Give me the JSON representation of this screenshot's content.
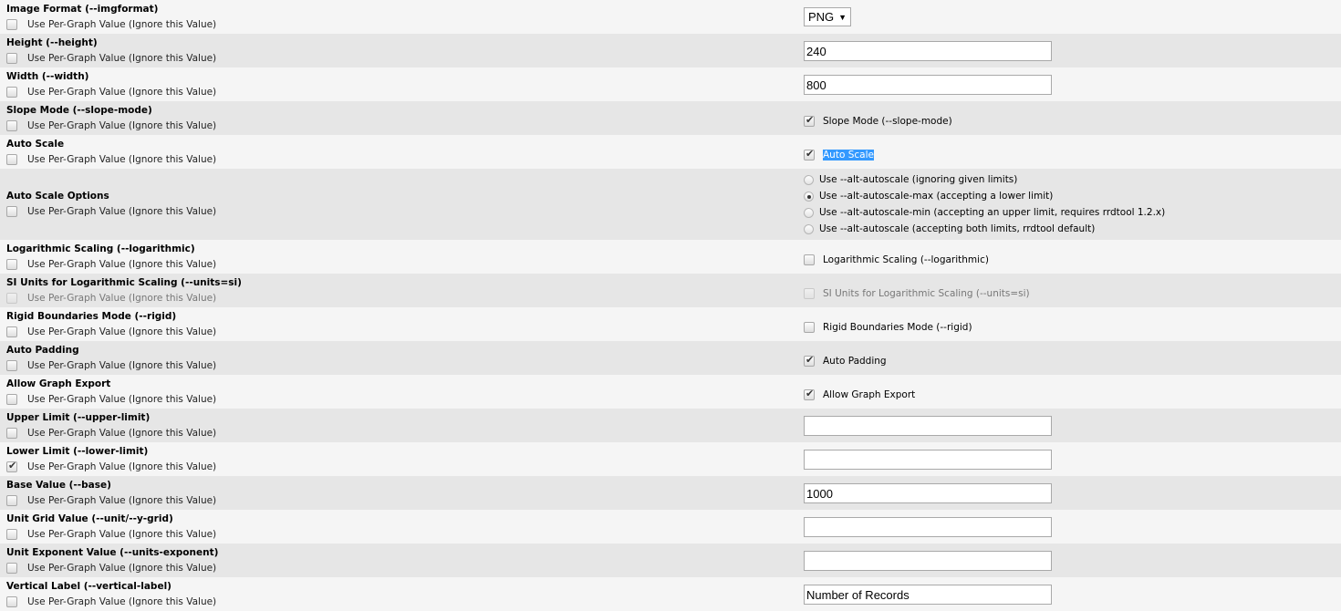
{
  "per_graph_label": "Use Per-Graph Value (Ignore this Value)",
  "rows": [
    {
      "label": "Image Format (--imgformat)",
      "type": "select",
      "value": "PNG",
      "per_graph": false
    },
    {
      "label": "Height (--height)",
      "type": "text",
      "value": "240",
      "per_graph": false
    },
    {
      "label": "Width (--width)",
      "type": "text",
      "value": "800",
      "per_graph": false
    },
    {
      "label": "Slope Mode (--slope-mode)",
      "type": "checkbox",
      "checked": true,
      "text": "Slope Mode (--slope-mode)",
      "per_graph": false
    },
    {
      "label": "Auto Scale",
      "type": "checkbox",
      "checked": true,
      "text": "Auto Scale",
      "highlight": true,
      "per_graph": false
    },
    {
      "label": "Auto Scale Options",
      "type": "radio",
      "per_graph": false,
      "options": [
        {
          "text": "Use --alt-autoscale (ignoring given limits)",
          "selected": false
        },
        {
          "text": "Use --alt-autoscale-max (accepting a lower limit)",
          "selected": true
        },
        {
          "text": "Use --alt-autoscale-min (accepting an upper limit, requires rrdtool 1.2.x)",
          "selected": false
        },
        {
          "text": "Use --alt-autoscale (accepting both limits, rrdtool default)",
          "selected": false
        }
      ]
    },
    {
      "label": "Logarithmic Scaling (--logarithmic)",
      "type": "checkbox",
      "checked": false,
      "text": "Logarithmic Scaling (--logarithmic)",
      "per_graph": false
    },
    {
      "label": "SI Units for Logarithmic Scaling (--units=si)",
      "type": "checkbox",
      "checked": false,
      "disabled": true,
      "text": "SI Units for Logarithmic Scaling (--units=si)",
      "per_graph": false
    },
    {
      "label": "Rigid Boundaries Mode (--rigid)",
      "type": "checkbox",
      "checked": false,
      "text": "Rigid Boundaries Mode (--rigid)",
      "per_graph": false
    },
    {
      "label": "Auto Padding",
      "type": "checkbox",
      "checked": true,
      "text": "Auto Padding",
      "per_graph": false
    },
    {
      "label": "Allow Graph Export",
      "type": "checkbox",
      "checked": true,
      "text": "Allow Graph Export",
      "per_graph": false
    },
    {
      "label": "Upper Limit (--upper-limit)",
      "type": "text",
      "value": "",
      "per_graph": false
    },
    {
      "label": "Lower Limit (--lower-limit)",
      "type": "text",
      "value": "",
      "per_graph": true
    },
    {
      "label": "Base Value (--base)",
      "type": "text",
      "value": "1000",
      "per_graph": false
    },
    {
      "label": "Unit Grid Value (--unit/--y-grid)",
      "type": "text",
      "value": "",
      "per_graph": false
    },
    {
      "label": "Unit Exponent Value (--units-exponent)",
      "type": "text",
      "value": "",
      "per_graph": false
    },
    {
      "label": "Vertical Label (--vertical-label)",
      "type": "text",
      "value": "Number of Records",
      "per_graph": false
    }
  ]
}
